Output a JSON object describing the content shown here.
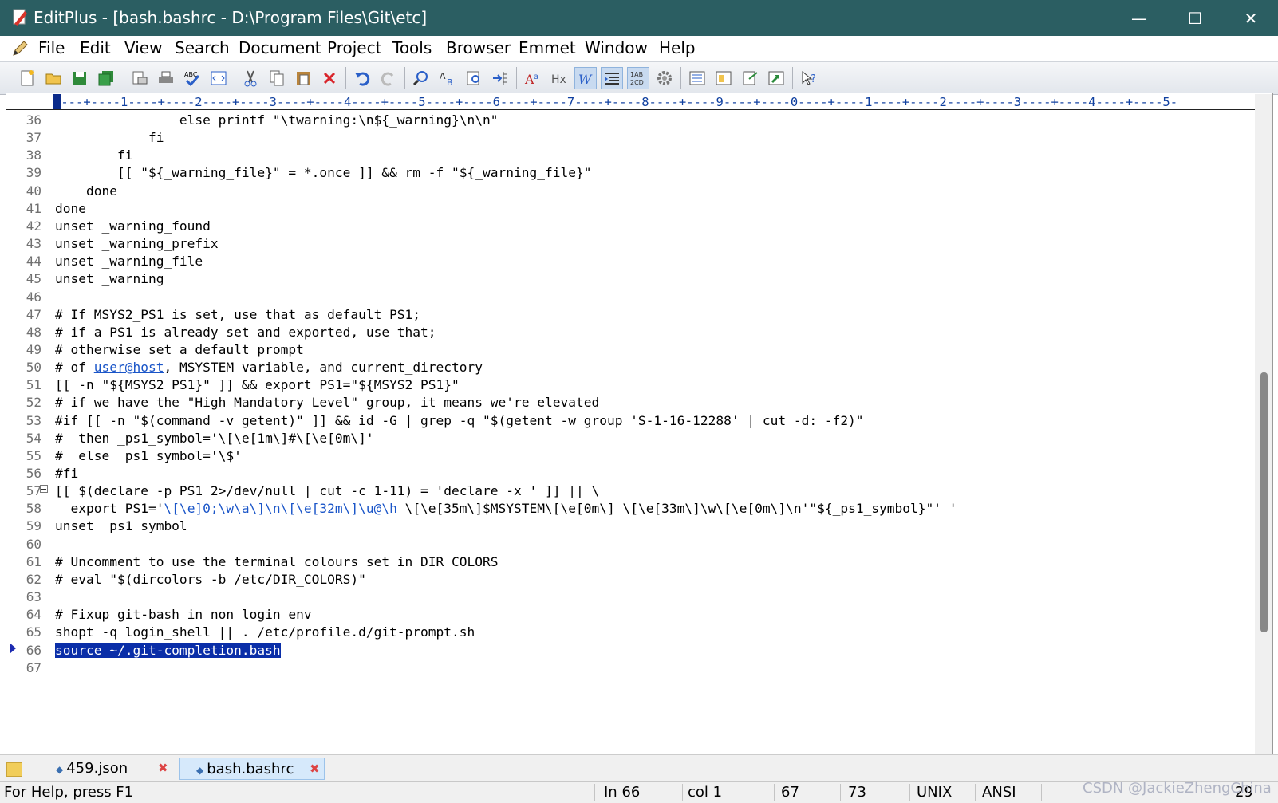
{
  "window": {
    "title": "EditPlus - [bash.bashrc - D:\\Program Files\\Git\\etc]",
    "minimize_glyph": "—",
    "maximize_glyph": "☐",
    "close_glyph": "✕"
  },
  "menu": [
    "File",
    "Edit",
    "View",
    "Search",
    "Document",
    "Project",
    "Tools",
    "Browser",
    "Emmet",
    "Window",
    "Help"
  ],
  "mdi": {
    "minimize": "–",
    "restore": "▫",
    "close": "✕"
  },
  "toolbar": {
    "buttons": [
      "new-file",
      "open-file",
      "save",
      "save-all",
      "print-preview",
      "print",
      "spell-check",
      "browser-view",
      "cut",
      "copy",
      "paste",
      "delete",
      "undo",
      "redo",
      "find",
      "replace",
      "find-in-files",
      "go-to-line",
      "font",
      "html-toolbar",
      "word-wrap",
      "indent",
      "column-select",
      "settings",
      "directory-window",
      "clip-text",
      "cliptext-window",
      "output-window",
      "help"
    ]
  },
  "ruler": {
    "text": "----+----1----+----2----+----3----+----4----+----5----+----6----+----7----+----8----+----9----+----0----+----1----+----2----+----3----+----4----+----5-"
  },
  "editor": {
    "lines": [
      {
        "n": "36",
        "text": "                else printf \"\\twarning:\\n${_warning}\\n\\n\""
      },
      {
        "n": "37",
        "text": "            fi"
      },
      {
        "n": "38",
        "text": "        fi"
      },
      {
        "n": "39",
        "text": "        [[ \"${_warning_file}\" = *.once ]] && rm -f \"${_warning_file}\""
      },
      {
        "n": "40",
        "text": "    done"
      },
      {
        "n": "41",
        "text": "done"
      },
      {
        "n": "42",
        "text": "unset _warning_found"
      },
      {
        "n": "43",
        "text": "unset _warning_prefix"
      },
      {
        "n": "44",
        "text": "unset _warning_file"
      },
      {
        "n": "45",
        "text": "unset _warning"
      },
      {
        "n": "46",
        "text": ""
      },
      {
        "n": "47",
        "text": "# If MSYS2_PS1 is set, use that as default PS1;"
      },
      {
        "n": "48",
        "text": "# if a PS1 is already set and exported, use that;"
      },
      {
        "n": "49",
        "text": "# otherwise set a default prompt"
      },
      {
        "n": "50",
        "pre": "# of ",
        "link": "user@host",
        "post": ", MSYSTEM variable, and current_directory"
      },
      {
        "n": "51",
        "text": "[[ -n \"${MSYS2_PS1}\" ]] && export PS1=\"${MSYS2_PS1}\""
      },
      {
        "n": "52",
        "text": "# if we have the \"High Mandatory Level\" group, it means we're elevated"
      },
      {
        "n": "53",
        "text": "#if [[ -n \"$(command -v getent)\" ]] && id -G | grep -q \"$(getent -w group 'S-1-16-12288' | cut -d: -f2)\""
      },
      {
        "n": "54",
        "text": "#  then _ps1_symbol='\\[\\e[1m\\]#\\[\\e[0m\\]'"
      },
      {
        "n": "55",
        "text": "#  else _ps1_symbol='\\$'"
      },
      {
        "n": "56",
        "text": "#fi"
      },
      {
        "n": "57",
        "text": "[[ $(declare -p PS1 2>/dev/null | cut -c 1-11) = 'declare -x ' ]] || \\"
      },
      {
        "n": "58",
        "pre": "  export PS1='",
        "link": "\\[\\e]0;\\w\\a\\]\\n\\[\\e[32m\\]\\u@\\h",
        "post": " \\[\\e[35m\\]$MSYSTEM\\[\\e[0m\\] \\[\\e[33m\\]\\w\\[\\e[0m\\]\\n'\"${_ps1_symbol}\"' '"
      },
      {
        "n": "59",
        "text": "unset _ps1_symbol"
      },
      {
        "n": "60",
        "text": ""
      },
      {
        "n": "61",
        "text": "# Uncomment to use the terminal colours set in DIR_COLORS"
      },
      {
        "n": "62",
        "text": "# eval \"$(dircolors -b /etc/DIR_COLORS)\""
      },
      {
        "n": "63",
        "text": ""
      },
      {
        "n": "64",
        "text": "# Fixup git-bash in non login env"
      },
      {
        "n": "65",
        "text": "shopt -q login_shell || . /etc/profile.d/git-prompt.sh"
      },
      {
        "n": "66",
        "sel": "source ~/.git-completion.bash"
      },
      {
        "n": "67",
        "text": ""
      }
    ]
  },
  "tabs": [
    {
      "label": "459.json",
      "active": false
    },
    {
      "label": "bash.bashrc",
      "active": true
    }
  ],
  "tab_close_glyph": "✖",
  "status": {
    "help": "For Help, press F1",
    "line": "In 66",
    "col": "col 1",
    "num1": "67",
    "num2": "73",
    "eol": "UNIX",
    "enc": "ANSI",
    "extra": "29"
  },
  "watermark": "CSDN @JackieZhengChina",
  "colors": {
    "titlebar": "#2b5e62",
    "selection": "#0a2ea8",
    "link": "#1a55c8",
    "ruler": "#1040a0"
  }
}
